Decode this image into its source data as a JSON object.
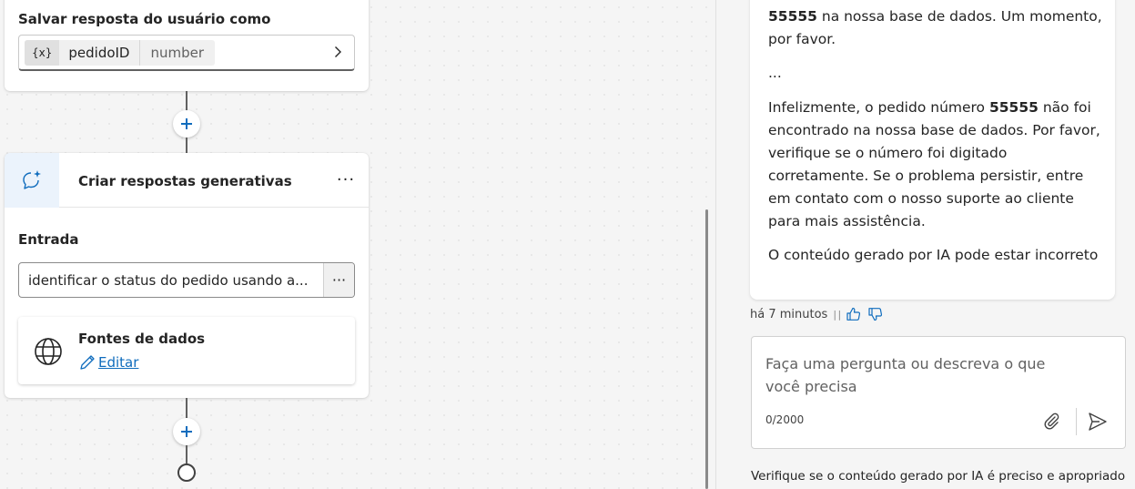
{
  "canvas": {
    "save_node": {
      "title": "Salvar resposta do usuário como",
      "variable_icon": "{x}",
      "variable_name": "pedidoID",
      "variable_type": "number"
    },
    "generative_node": {
      "title": "Criar respostas generativas",
      "more_label": "···",
      "input_label": "Entrada",
      "input_value": "identificar o status do pedido usando a...",
      "input_more": "···",
      "datasources_title": "Fontes de dados",
      "edit_label": "Editar"
    }
  },
  "chat": {
    "message": {
      "line1_bold": "55555",
      "line1_rest": " na nossa base de dados. Um momento, por favor.",
      "ellipsis": "...",
      "p2_start": "Infelizmente, o pedido número ",
      "p2_bold": "55555",
      "p2_rest": " não foi encontrado na nossa base de dados. Por favor, verifique se o número foi digitado corretamente. Se o problema persistir, entre em contato com o nosso suporte ao cliente para mais assistência.",
      "ai_note": "O conteúdo gerado por IA pode estar incorreto"
    },
    "timestamp": "há 7 minutos",
    "input": {
      "placeholder": "Faça uma pergunta ou descreva o que você precisa",
      "char_count": "0/2000"
    },
    "disclaimer": "Verifique se o conteúdo gerado por IA é preciso e apropriado"
  },
  "icons": {
    "variable": "variable-icon",
    "chevron": "chevron-right-icon",
    "add": "plus-icon",
    "generative": "sparkle-chat-icon",
    "globe": "globe-icon",
    "edit": "pencil-icon",
    "thumbs_up": "thumbs-up-icon",
    "thumbs_down": "thumbs-down-icon",
    "attach": "paperclip-icon",
    "send": "send-icon"
  },
  "colors": {
    "accent": "#0f6cbd",
    "canvas_bg": "#f5f5f5",
    "icon_tile_bg": "#ebf3fc"
  }
}
